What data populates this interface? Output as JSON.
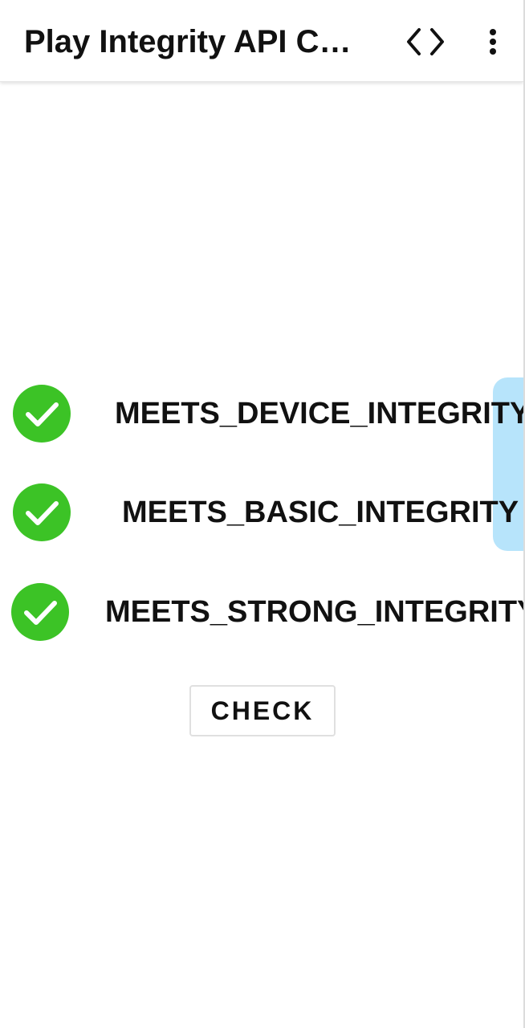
{
  "appbar": {
    "title": "Play Integrity API C…",
    "code_icon": "code-icon",
    "menu_icon": "more-vert-icon"
  },
  "integrity_checks": [
    {
      "label": "MEETS_DEVICE_INTEGRITY",
      "status": "passed",
      "icon": "check-circle-icon"
    },
    {
      "label": "MEETS_BASIC_INTEGRITY",
      "status": "passed",
      "icon": "check-circle-icon"
    },
    {
      "label": "MEETS_STRONG_INTEGRITY",
      "status": "passed",
      "icon": "check-circle-icon"
    }
  ],
  "check_button": {
    "label": "CHECK"
  },
  "colors": {
    "check_green": "#3cc326",
    "side_tab": "#b3e3fb",
    "text": "#111111"
  }
}
